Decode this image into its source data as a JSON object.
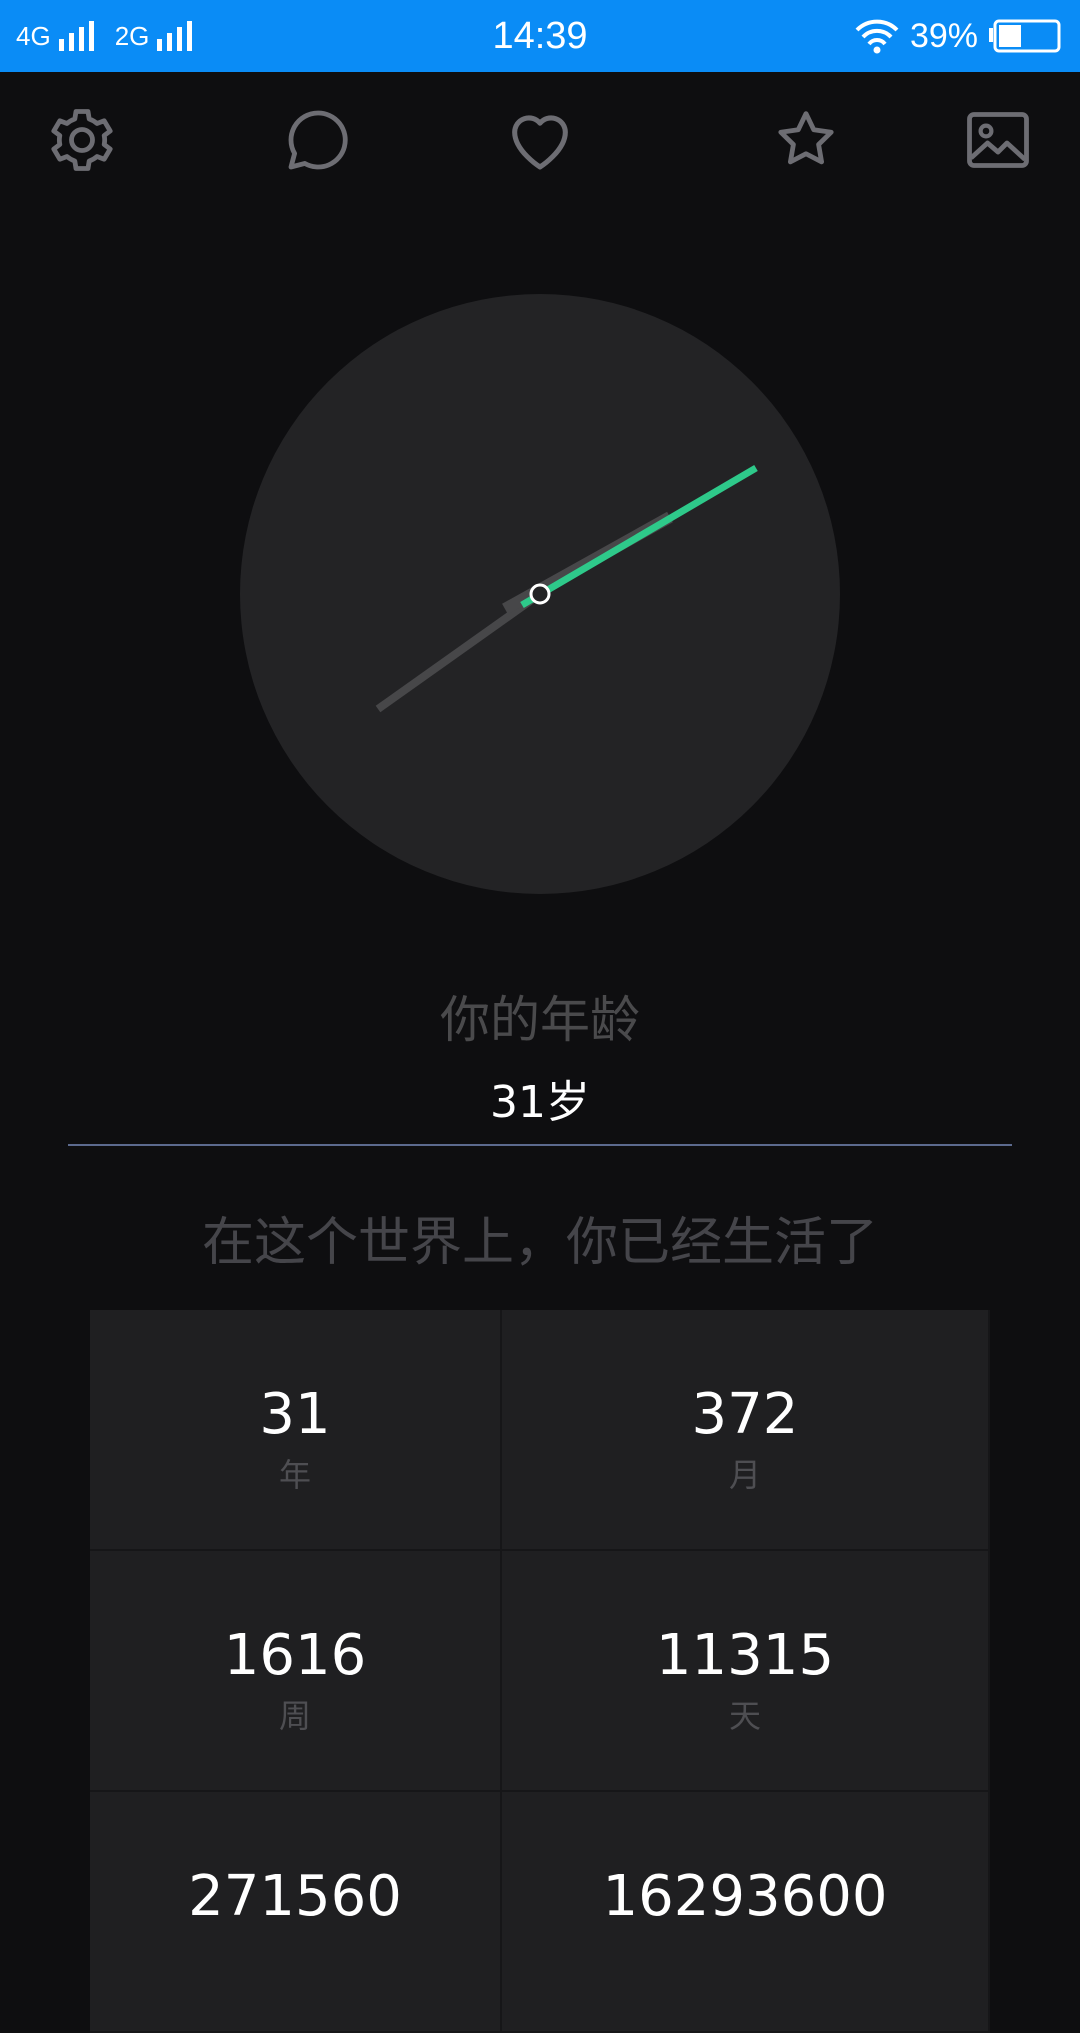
{
  "status_bar": {
    "network1": "4G",
    "network2": "2G",
    "time": "14:39",
    "battery_percent": "39%",
    "battery_level": 0.39
  },
  "toolbar": {
    "icons": [
      "gear-icon",
      "chat-bubble-icon",
      "heart-icon",
      "star-icon",
      "image-icon"
    ]
  },
  "dial": {
    "accent_color": "#2ec98a"
  },
  "age": {
    "label": "你的年龄",
    "value": "31岁"
  },
  "lived": {
    "text": "在这个世界上，你已经生活了"
  },
  "stats": [
    {
      "value": "31",
      "unit": "年"
    },
    {
      "value": "372",
      "unit": "月"
    },
    {
      "value": "1616",
      "unit": "周"
    },
    {
      "value": "11315",
      "unit": "天"
    },
    {
      "value": "271560",
      "unit": ""
    },
    {
      "value": "16293600",
      "unit": ""
    }
  ]
}
